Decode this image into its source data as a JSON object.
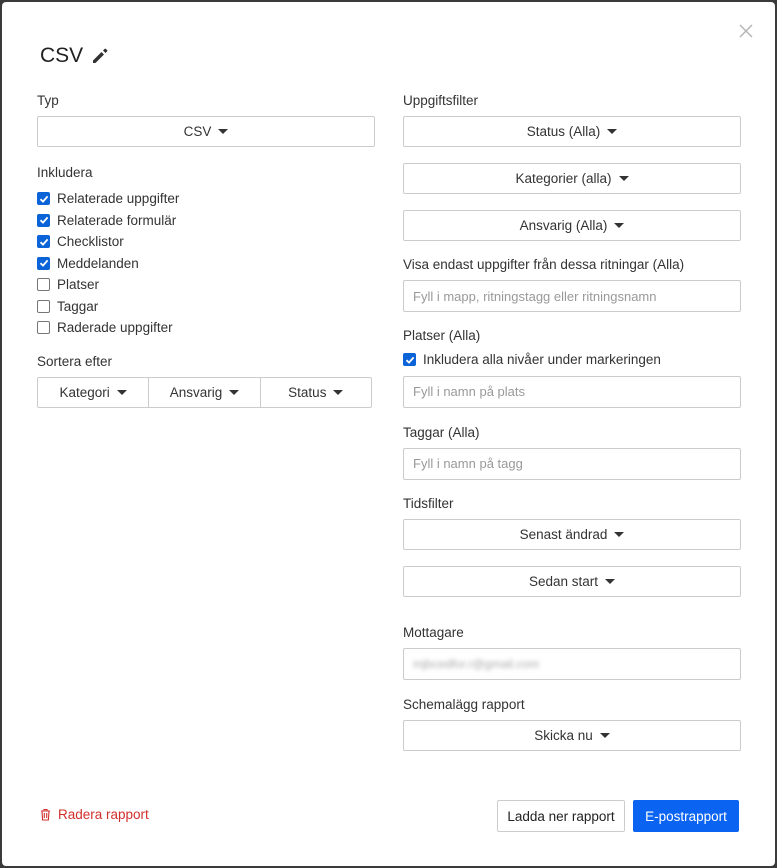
{
  "title": "CSV",
  "left": {
    "type_label": "Typ",
    "type_value": "CSV",
    "include_label": "Inkludera",
    "include_items": [
      {
        "label": "Relaterade uppgifter",
        "checked": true
      },
      {
        "label": "Relaterade formulär",
        "checked": true
      },
      {
        "label": "Checklistor",
        "checked": true
      },
      {
        "label": "Meddelanden",
        "checked": true
      },
      {
        "label": "Platser",
        "checked": false
      },
      {
        "label": "Taggar",
        "checked": false
      },
      {
        "label": "Raderade uppgifter",
        "checked": false
      }
    ],
    "sort_label": "Sortera efter",
    "sort_options": [
      "Kategori",
      "Ansvarig",
      "Status"
    ]
  },
  "right": {
    "task_filter_label": "Uppgiftsfilter",
    "status_dropdown": "Status (Alla)",
    "categories_dropdown": "Kategorier (alla)",
    "responsible_dropdown": "Ansvarig (Alla)",
    "drawings_label": "Visa endast uppgifter från dessa ritningar (Alla)",
    "drawings_placeholder": "Fyll i mapp, ritningstagg eller ritningsnamn",
    "places_label": "Platser (Alla)",
    "include_levels_label": "Inkludera alla nivåer under markeringen",
    "include_levels_checked": true,
    "places_placeholder": "Fyll i namn på plats",
    "tags_label": "Taggar (Alla)",
    "tags_placeholder": "Fyll i namn på tagg",
    "time_filter_label": "Tidsfilter",
    "last_modified_dropdown": "Senast ändrad",
    "since_start_dropdown": "Sedan start",
    "recipients_label": "Mottagare",
    "recipient_value": "mjbcedfor.r@gmail.com",
    "schedule_label": "Schemalägg rapport",
    "schedule_dropdown": "Skicka nu"
  },
  "footer": {
    "delete_label": "Radera rapport",
    "download_label": "Ladda ner rapport",
    "email_label": "E-postrapport"
  },
  "colors": {
    "primary": "#0b63f2",
    "danger": "#d0312d",
    "checkbox": "#0b63d8"
  }
}
